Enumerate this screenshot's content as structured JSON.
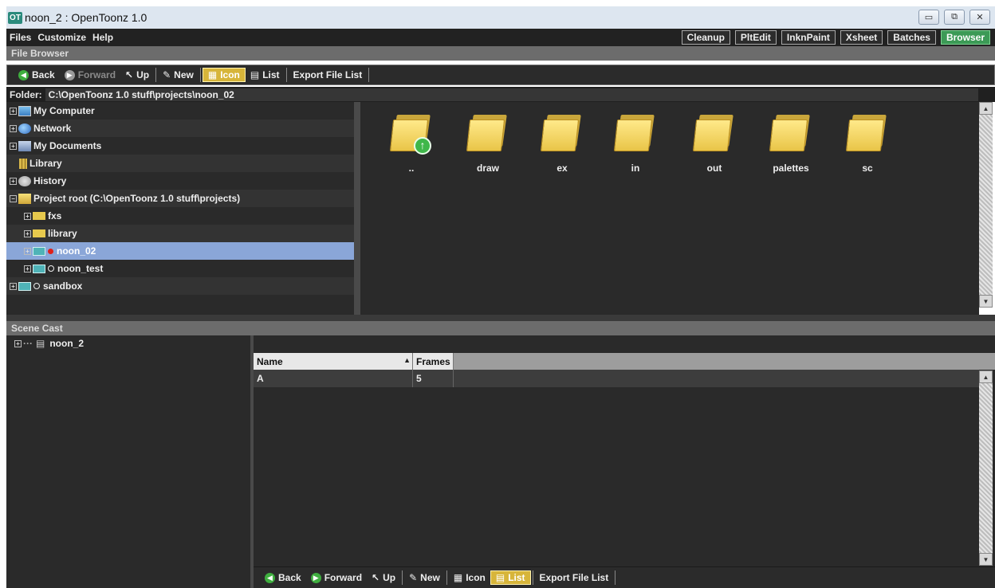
{
  "window": {
    "app_icon_text": "OT",
    "title": "noon_2 : OpenToonz 1.0",
    "minimize_glyph": "▭",
    "restore_glyph": "⧉",
    "close_glyph": "✕"
  },
  "menu": [
    "Files",
    "Customize",
    "Help"
  ],
  "rooms": [
    "Cleanup",
    "PltEdit",
    "InknPaint",
    "Xsheet",
    "Batches",
    "Browser"
  ],
  "active_room": "Browser",
  "file_browser": {
    "panel_title": "File Browser",
    "toolbar": {
      "back": "Back",
      "forward": "Forward",
      "up": "Up",
      "new": "New",
      "icon": "Icon",
      "list": "List",
      "export": "Export File List"
    },
    "folder_label": "Folder:",
    "folder_path": "C:\\OpenToonz 1.0 stuff\\projects\\noon_02",
    "tree": [
      {
        "label": "My Computer",
        "icon": "computer-icon"
      },
      {
        "label": "Network",
        "icon": "globe-icon"
      },
      {
        "label": "My Documents",
        "icon": "documents-icon"
      },
      {
        "label": "Library",
        "icon": "library-icon"
      },
      {
        "label": "History",
        "icon": "history-icon"
      },
      {
        "label": "Project root (C:\\OpenToonz 1.0 stuff\\projects)",
        "icon": "project-root-icon"
      },
      {
        "label": "fxs",
        "icon": "folder-icon"
      },
      {
        "label": "library",
        "icon": "folder-icon"
      },
      {
        "label": "noon_02",
        "icon": "project-icon",
        "selected": true,
        "status": "current"
      },
      {
        "label": "noon_test",
        "icon": "project-icon",
        "status": "other"
      },
      {
        "label": "sandbox",
        "icon": "project-icon",
        "status": "other"
      }
    ],
    "folders": [
      "..",
      "draw",
      "ex",
      "in",
      "out",
      "palettes",
      "sc"
    ]
  },
  "scene_cast": {
    "panel_title": "Scene Cast",
    "tree_root": "noon_2",
    "columns": [
      "Name",
      "Frames"
    ],
    "rows": [
      {
        "name": "A",
        "frames": "5"
      }
    ],
    "toolbar": {
      "back": "Back",
      "forward": "Forward",
      "up": "Up",
      "new": "New",
      "icon": "Icon",
      "list": "List",
      "export": "Export File List"
    }
  },
  "colors": {
    "panel_bg": "#2a2a2a",
    "selection": "#8aa6d8",
    "active_room": "#3c9a56",
    "active_toggle": "#d7b53a"
  }
}
